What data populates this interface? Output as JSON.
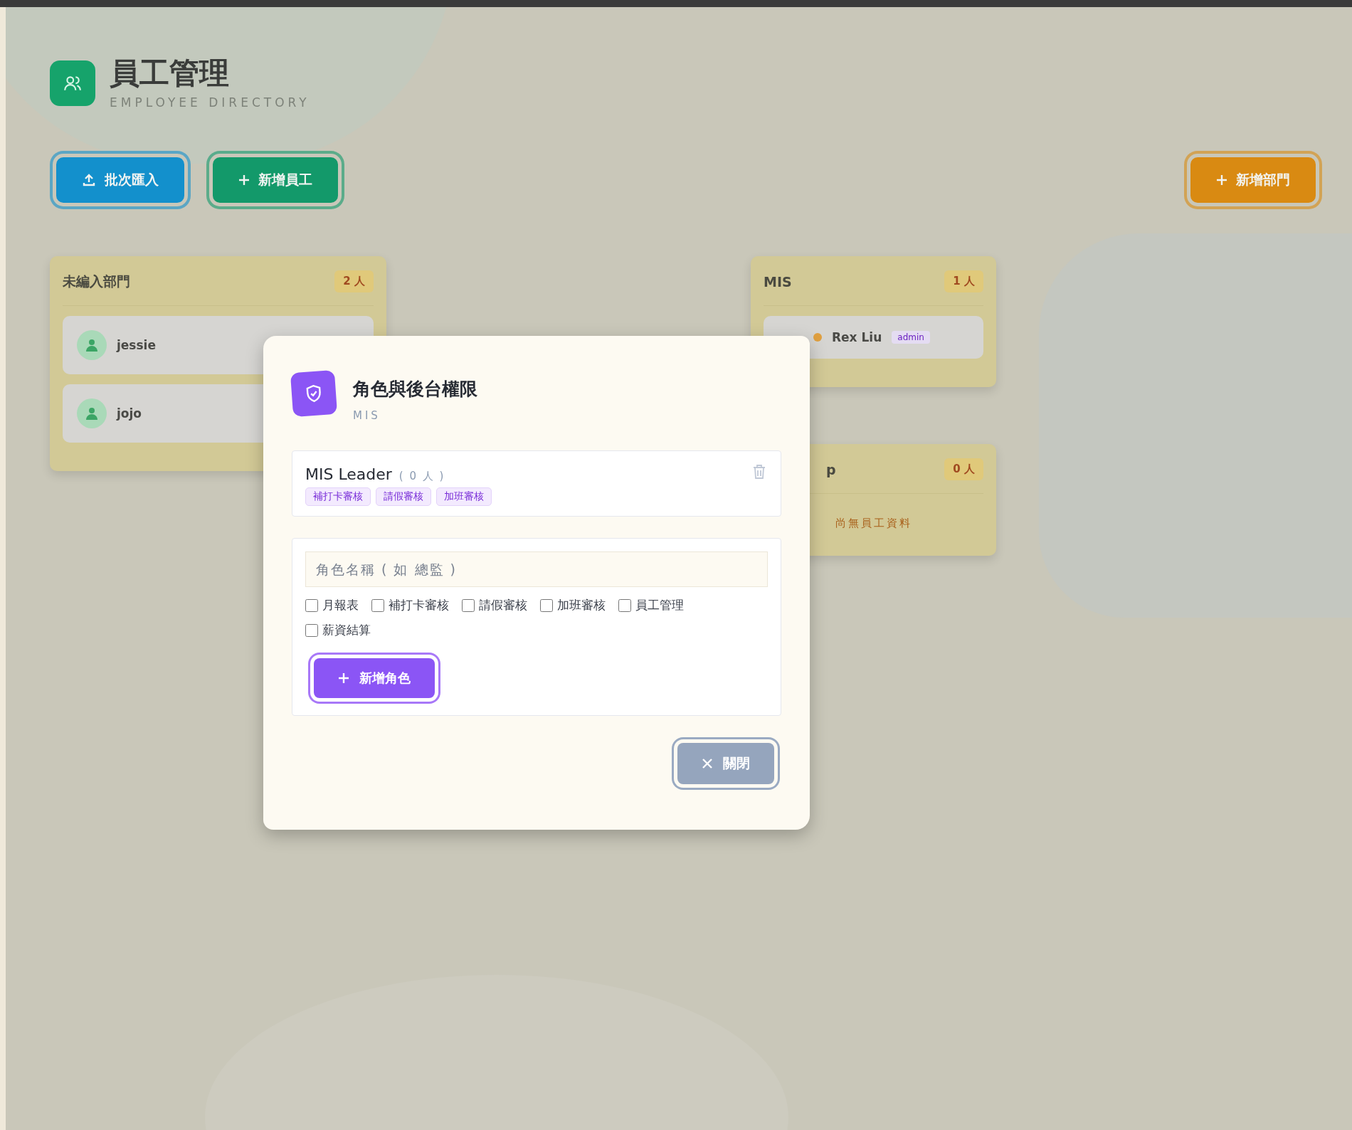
{
  "header": {
    "title": "員工管理",
    "subtitle": "EMPLOYEE DIRECTORY"
  },
  "toolbar": [
    {
      "kind": "import",
      "label": "批次匯入"
    },
    {
      "kind": "add",
      "label": "新增員工"
    }
  ],
  "add_department_button": {
    "label": "新增部門"
  },
  "departments": [
    {
      "name": "未編入部門",
      "count": "2 人",
      "employees": [
        {
          "name": "jessie"
        },
        {
          "name": "jojo"
        }
      ]
    },
    {
      "name": "MIS",
      "count": "1 人",
      "employees": [
        {
          "name": "Rex Liu",
          "role": "admin"
        }
      ]
    },
    {
      "name": "p",
      "count": "0 人",
      "empty_message": "尚無員工資料"
    }
  ],
  "dialog": {
    "title": "角色與後台權限",
    "subtitle": "MIS",
    "roles": [
      {
        "name": "MIS Leader",
        "count": "( 0 人 )",
        "permissions": [
          "補打卡審核",
          "請假審核",
          "加班審核"
        ]
      }
    ],
    "form": {
      "placeholder": "角色名稱 ( 如 總監 )",
      "permissions": [
        {
          "label": "月報表",
          "checked": false
        },
        {
          "label": "補打卡審核",
          "checked": false
        },
        {
          "label": "請假審核",
          "checked": false
        },
        {
          "label": "加班審核",
          "checked": false
        },
        {
          "label": "員工管理",
          "checked": false
        },
        {
          "label": "薪資結算",
          "checked": false
        }
      ],
      "submit": "新增角色"
    },
    "close": "關閉"
  }
}
